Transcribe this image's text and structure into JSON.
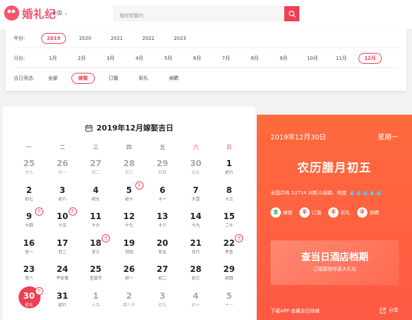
{
  "header": {
    "logo_text": "婚礼纪",
    "city": "全国",
    "search_placeholder": "搜你想要的"
  },
  "filters": {
    "year_label": "年份:",
    "years": [
      "2019",
      "2020",
      "2021",
      "2022",
      "2023"
    ],
    "selected_year": "2019",
    "month_label": "月份:",
    "months": [
      "1月",
      "2月",
      "3月",
      "4月",
      "5月",
      "6月",
      "7月",
      "8月",
      "9月",
      "10月",
      "11月",
      "12月"
    ],
    "selected_month": "12月",
    "type_label": "吉日筛选:",
    "types": [
      "全部",
      "嫁娶",
      "订婚",
      "彩礼",
      "纳聘"
    ],
    "selected_type": "嫁娶"
  },
  "calendar": {
    "title": "2019年12月嫁娶吉日",
    "weekdays": [
      "一",
      "二",
      "三",
      "四",
      "五",
      "六",
      "日"
    ],
    "weeks": [
      [
        {
          "d": "25",
          "l": "廿九",
          "other": true
        },
        {
          "d": "26",
          "l": "初一",
          "other": true
        },
        {
          "d": "27",
          "l": "初二",
          "other": true
        },
        {
          "d": "28",
          "l": "初三",
          "other": true
        },
        {
          "d": "29",
          "l": "初四",
          "other": true
        },
        {
          "d": "30",
          "l": "初五",
          "other": true
        },
        {
          "d": "1",
          "l": "初六"
        }
      ],
      [
        {
          "d": "2",
          "l": "初七"
        },
        {
          "d": "3",
          "l": "初八"
        },
        {
          "d": "4",
          "l": "初九"
        },
        {
          "d": "5",
          "l": "初十",
          "tag": "吉"
        },
        {
          "d": "6",
          "l": "十一"
        },
        {
          "d": "7",
          "l": "大雪"
        },
        {
          "d": "8",
          "l": "十三"
        }
      ],
      [
        {
          "d": "9",
          "l": "十四",
          "tag": "吉"
        },
        {
          "d": "10",
          "l": "十五",
          "tag": "吉"
        },
        {
          "d": "11",
          "l": "十六"
        },
        {
          "d": "12",
          "l": "十七"
        },
        {
          "d": "13",
          "l": "十八"
        },
        {
          "d": "14",
          "l": "十九"
        },
        {
          "d": "15",
          "l": "二十"
        }
      ],
      [
        {
          "d": "16",
          "l": "廿一"
        },
        {
          "d": "17",
          "l": "廿二"
        },
        {
          "d": "18",
          "l": "廿三",
          "tag": "吉"
        },
        {
          "d": "19",
          "l": "廿四"
        },
        {
          "d": "20",
          "l": "廿五"
        },
        {
          "d": "21",
          "l": "廿六"
        },
        {
          "d": "22",
          "l": "冬至",
          "tag": "吉"
        }
      ],
      [
        {
          "d": "23",
          "l": "廿八"
        },
        {
          "d": "24",
          "l": "平安夜"
        },
        {
          "d": "25",
          "l": "圣诞节"
        },
        {
          "d": "26",
          "l": "初一"
        },
        {
          "d": "27",
          "l": "初二"
        },
        {
          "d": "28",
          "l": "初三"
        },
        {
          "d": "29",
          "l": "初四"
        }
      ],
      [
        {
          "d": "30",
          "l": "初五",
          "tag": "吉",
          "selected": true
        },
        {
          "d": "31",
          "l": "初六"
        },
        {
          "d": "1",
          "l": "元旦",
          "other": true
        },
        {
          "d": "2",
          "l": "腊八节",
          "other": true
        },
        {
          "d": "3",
          "l": "初九",
          "other": true
        },
        {
          "d": "4",
          "l": "初十",
          "other": true
        },
        {
          "d": "5",
          "l": "十一",
          "other": true
        }
      ]
    ]
  },
  "panel": {
    "date": "2019年12月30日",
    "weekday": "星期一",
    "lunar": "农历腊月初五",
    "stats_text": "全国共有 13714 对新人结婚，热度",
    "heat_drops": "💧💧💧💧💧",
    "tags": [
      {
        "badge": "宜",
        "label": "嫁娶",
        "kind": "good"
      },
      {
        "badge": "平",
        "label": "订婚",
        "kind": "avg"
      },
      {
        "badge": "平",
        "label": "彩礼",
        "kind": "avg"
      },
      {
        "badge": "平",
        "label": "纳聘",
        "kind": "avg"
      }
    ],
    "promo_title": "查当日酒店档期",
    "promo_sub": "订婚宴赠惊喜大礼包",
    "footer_text": "下载APP 收藏吉日待嫁",
    "share_label": "分享"
  }
}
